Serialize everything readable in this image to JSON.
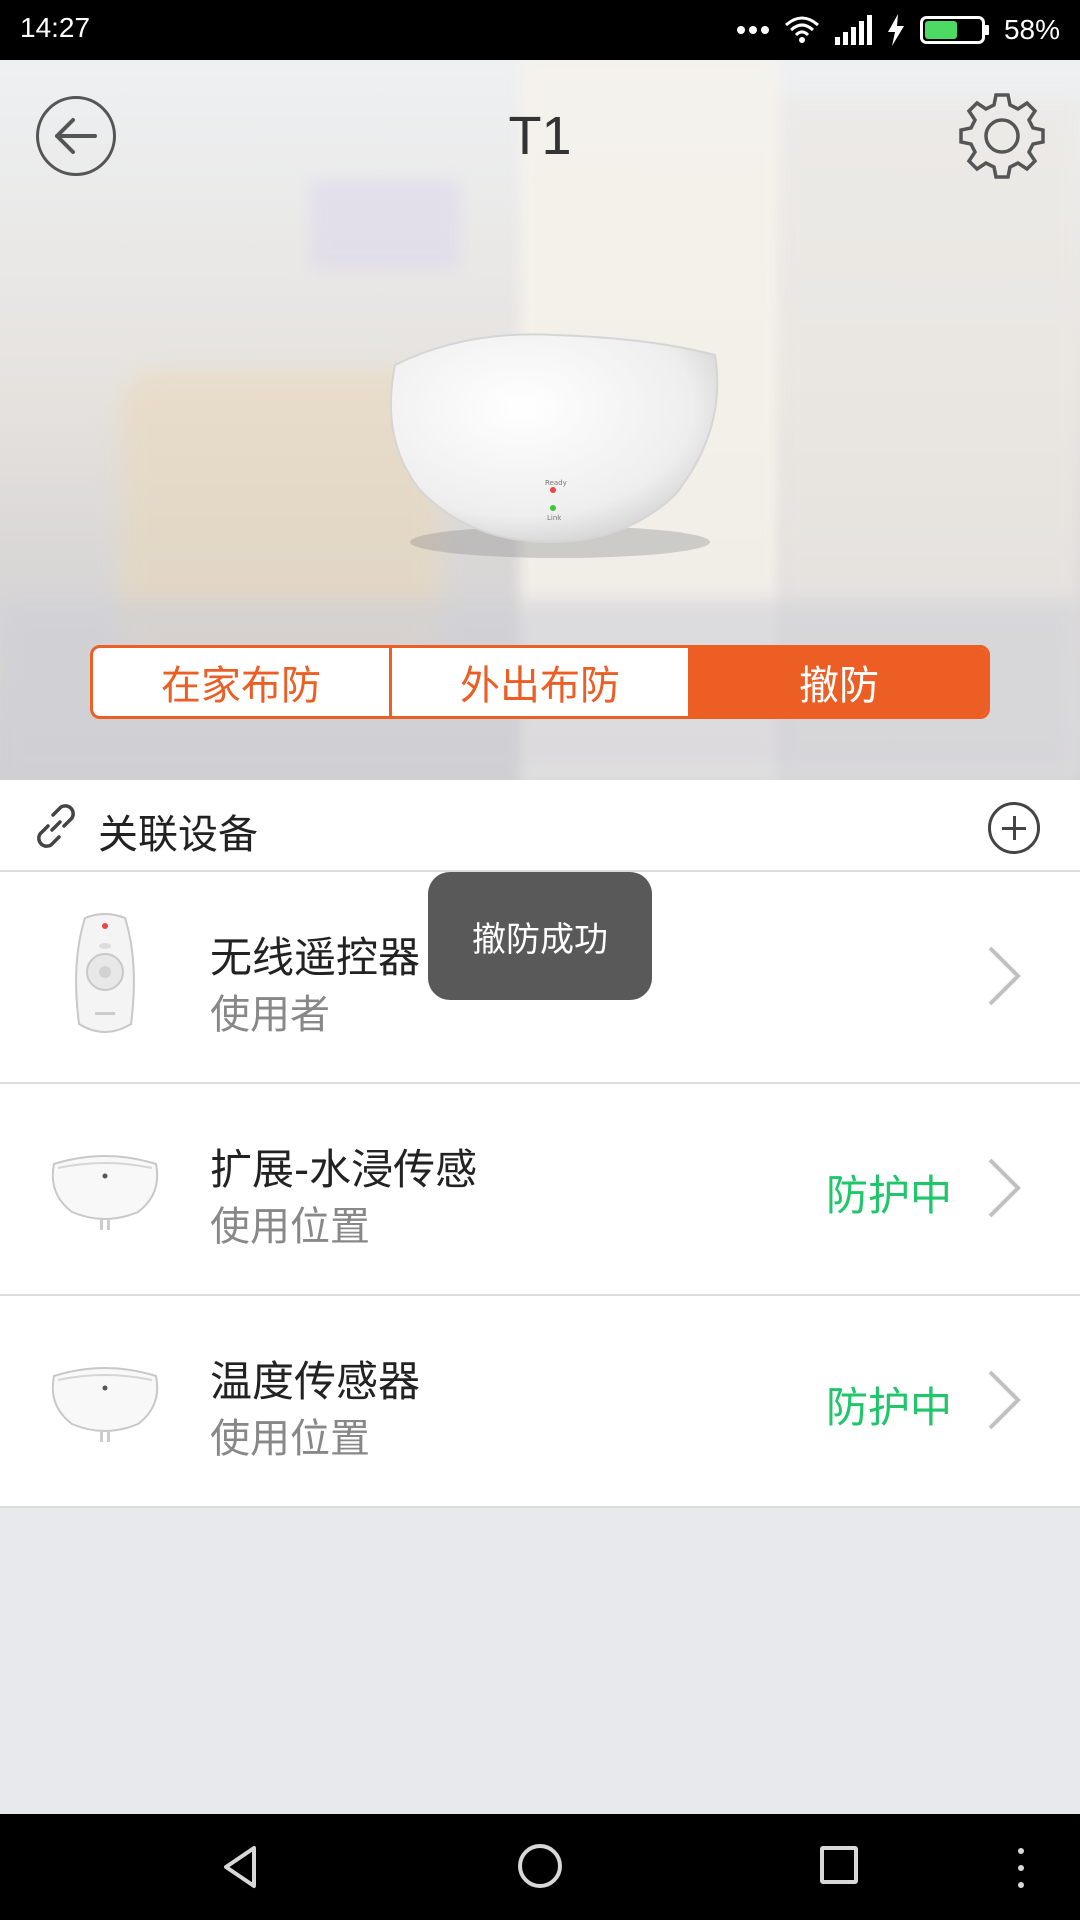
{
  "status_bar": {
    "time": "14:27",
    "battery_percent": "58%",
    "battery_level": 0.58,
    "icons": [
      "more-dots-icon",
      "wifi-icon",
      "signal-icon",
      "charging-icon",
      "battery-icon"
    ]
  },
  "header": {
    "title": "T1",
    "back_icon": "back-arrow-icon",
    "settings_icon": "gear-icon"
  },
  "security_modes": {
    "options": [
      {
        "label": "在家布防",
        "active": false
      },
      {
        "label": "外出布防",
        "active": false
      },
      {
        "label": "撤防",
        "active": true
      }
    ]
  },
  "linked_devices": {
    "title": "关联设备",
    "link_icon": "link-icon",
    "add_icon": "add-circle-icon",
    "items": [
      {
        "name": "无线遥控器",
        "subtitle": "使用者",
        "status": "",
        "thumb": "remote-control"
      },
      {
        "name": "扩展-水浸传感",
        "subtitle": "使用位置",
        "status": "防护中",
        "thumb": "water-sensor"
      },
      {
        "name": "温度传感器",
        "subtitle": "使用位置",
        "status": "防护中",
        "thumb": "temperature-sensor"
      }
    ]
  },
  "toast": {
    "message": "撤防成功"
  },
  "nav_bar": {
    "icons": [
      "nav-back-icon",
      "nav-home-icon",
      "nav-recent-icon",
      "nav-menu-icon"
    ]
  },
  "colors": {
    "accent": "#ec5e24",
    "status_green": "#1fc66a",
    "background": "#e8e9ec",
    "status_bar": "#000000"
  }
}
